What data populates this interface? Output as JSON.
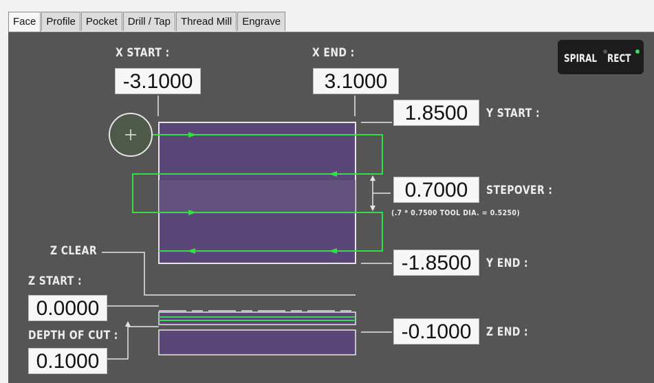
{
  "tabs": [
    {
      "label": "Face",
      "active": true
    },
    {
      "label": "Profile",
      "active": false
    },
    {
      "label": "Pocket",
      "active": false
    },
    {
      "label": "Drill / Tap",
      "active": false
    },
    {
      "label": "Thread Mill",
      "active": false
    },
    {
      "label": "Engrave",
      "active": false
    }
  ],
  "mode_toggle": {
    "spiral": "SPIRAL",
    "rect": "RECT",
    "selected": "RECT",
    "indicator_on": "#3ee05a",
    "indicator_off": "#555555"
  },
  "x_start": {
    "label": "X START :",
    "value": "-3.1000"
  },
  "x_end": {
    "label": "X END :",
    "value": "3.1000"
  },
  "y_start": {
    "label": "Y START :",
    "value": "1.8500"
  },
  "stepover": {
    "label": "STEPOVER :",
    "value": "0.7000",
    "note": "(.7 * 0.7500 TOOL DIA. = 0.5250)"
  },
  "y_end": {
    "label": "Y END :",
    "value": "-1.8500"
  },
  "z_clear": {
    "label": "Z CLEAR"
  },
  "z_start": {
    "label": "Z START :",
    "value": "0.0000"
  },
  "depth_of_cut": {
    "label": "DEPTH OF CUT :",
    "value": "0.1000"
  },
  "z_end": {
    "label": "Z END :",
    "value": "-0.1000"
  },
  "colors": {
    "background": "#555555",
    "part": "#5b4777",
    "toolpath": "#33e043",
    "field_bg": "#f7f7f7",
    "label": "#ededed"
  }
}
